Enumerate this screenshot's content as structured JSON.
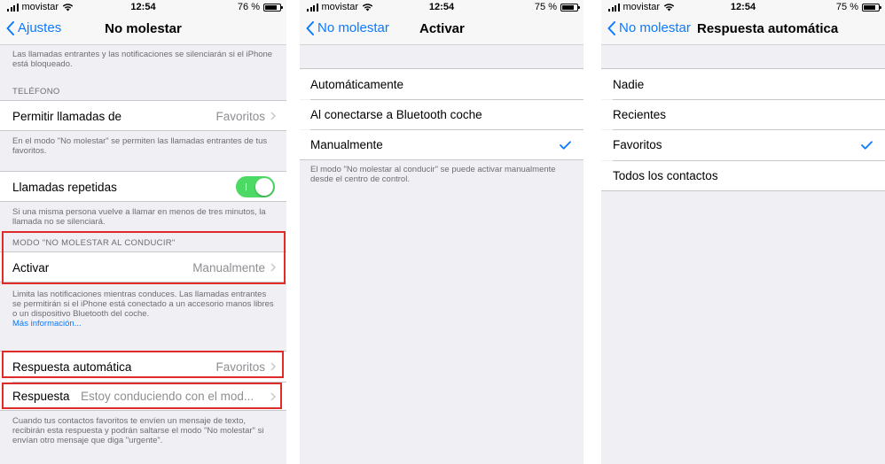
{
  "colors": {
    "accent": "#0a7aff",
    "toggle_on": "#4cd964",
    "highlight": "#e02b2b"
  },
  "screen1": {
    "status": {
      "carrier": "movistar",
      "time": "12:54",
      "battery": "76 %",
      "battery_level": 0.76
    },
    "nav": {
      "back": "Ajustes",
      "title": "No molestar"
    },
    "footer_top": "Las llamadas entrantes y las notificaciones se silenciarán si el iPhone está bloqueado.",
    "header_phone": "TELÉFONO",
    "allow_calls": {
      "label": "Permitir llamadas de",
      "value": "Favoritos"
    },
    "footer_allow": "En el modo \"No molestar\" se permiten las llamadas entrantes de tus favoritos.",
    "repeated": {
      "label": "Llamadas repetidas",
      "on": true
    },
    "footer_repeated": "Si una misma persona vuelve a llamar en menos de tres minutos, la llamada no se silenciará.",
    "header_driving": "MODO \"NO MOLESTAR AL CONDUCIR\"",
    "activate": {
      "label": "Activar",
      "value": "Manualmente"
    },
    "footer_activate": "Limita las notificaciones mientras conduces. Las llamadas entrantes se permitirán si el iPhone está conectado a un accesorio manos libres o un dispositivo Bluetooth del coche.",
    "more_info": "Más información...",
    "auto_reply": {
      "label": "Respuesta automática",
      "value": "Favoritos"
    },
    "reply": {
      "label": "Respuesta",
      "value": "Estoy conduciendo con el mod..."
    },
    "footer_reply": "Cuando tus contactos favoritos te envíen un mensaje de texto, recibirán esta respuesta y podrán saltarse el modo \"No molestar\" si envían otro mensaje que diga \"urgente\"."
  },
  "screen2": {
    "status": {
      "carrier": "movistar",
      "time": "12:54",
      "battery": "75 %",
      "battery_level": 0.75
    },
    "nav": {
      "back": "No molestar",
      "title": "Activar"
    },
    "options": [
      "Automáticamente",
      "Al conectarse a Bluetooth coche",
      "Manualmente"
    ],
    "selected_index": 2,
    "footer": "El modo \"No molestar al conducir\" se puede activar manualmente desde el centro de control."
  },
  "screen3": {
    "status": {
      "carrier": "movistar",
      "time": "12:54",
      "battery": "75 %",
      "battery_level": 0.75
    },
    "nav": {
      "back": "No molestar",
      "title": "Respuesta automática"
    },
    "options": [
      "Nadie",
      "Recientes",
      "Favoritos",
      "Todos los contactos"
    ],
    "selected_index": 2
  }
}
